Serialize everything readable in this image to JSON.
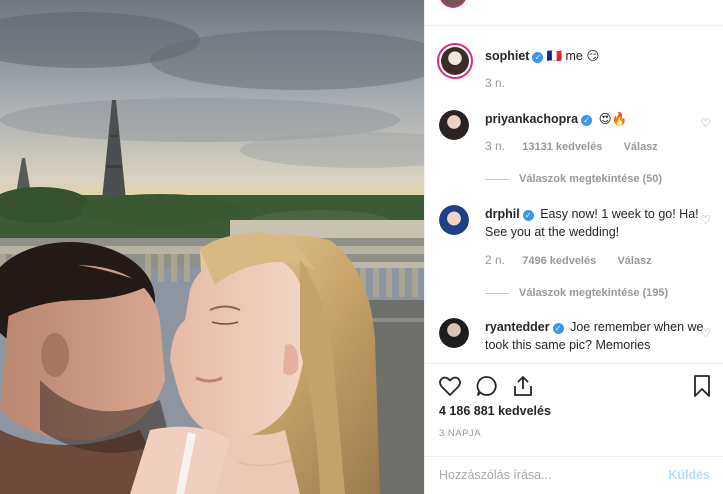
{
  "post": {
    "caption": {
      "username": "sophiet",
      "verified_glyph": "✓",
      "flag": "🇫🇷",
      "text": "me 😏",
      "time": "3 n."
    },
    "comments": [
      {
        "username": "priyankachopra",
        "text": "😍🔥",
        "time": "3 n.",
        "likes": "13131 kedvelés",
        "reply_label": "Válasz",
        "view_replies": "Válaszok megtekintése (50)"
      },
      {
        "username": "drphil",
        "text": "Easy now! 1 week to go! Ha! See you at the wedding!",
        "time": "2 n.",
        "likes": "7496 kedvelés",
        "reply_label": "Válasz",
        "view_replies": "Válaszok megtekintése (195)"
      },
      {
        "username": "ryantedder",
        "text": "Joe remember when we took this same pic? Memories"
      }
    ],
    "likes_total": "4 186 881 kedvelés",
    "date_label": "3 NAPJA",
    "comment_placeholder": "Hozzászólás írása...",
    "post_button": "Küldés"
  },
  "icons": {
    "like": "heart-icon",
    "comment": "comment-icon",
    "share": "share-icon",
    "save": "bookmark-icon",
    "comment_like": "small-heart-icon"
  },
  "colors": {
    "verified": "#3897f0",
    "story_ring": "#dd2a7b",
    "muted_text": "#999999",
    "post_button_disabled": "#b2dffc"
  }
}
